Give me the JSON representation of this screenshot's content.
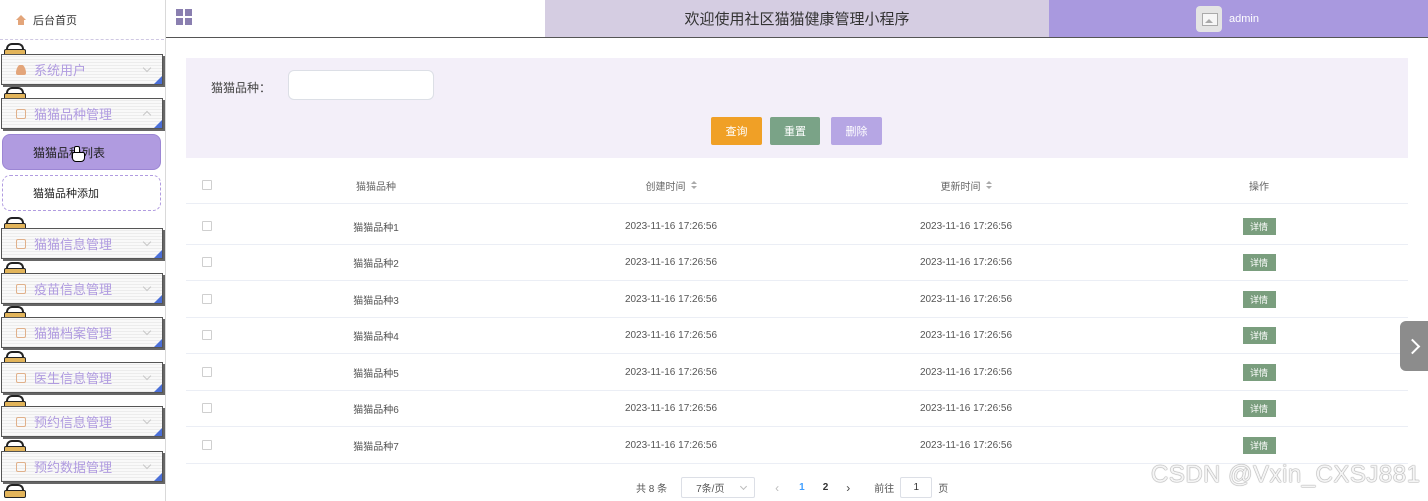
{
  "sidebar": {
    "home_label": "后台首页",
    "menus": [
      {
        "label": "系统用户",
        "icon": "user-icon"
      },
      {
        "label": "猫猫品种管理",
        "icon": "folder-icon"
      },
      {
        "label": "猫猫信息管理",
        "icon": "folder-icon"
      },
      {
        "label": "疫苗信息管理",
        "icon": "folder-icon"
      },
      {
        "label": "猫猫档案管理",
        "icon": "folder-icon"
      },
      {
        "label": "医生信息管理",
        "icon": "folder-icon"
      },
      {
        "label": "预约信息管理",
        "icon": "folder-icon"
      },
      {
        "label": "预约数据管理",
        "icon": "folder-icon"
      }
    ],
    "submenu": [
      {
        "label": "猫猫品种列表",
        "active": true
      },
      {
        "label": "猫猫品种添加",
        "active": false
      }
    ]
  },
  "header": {
    "title": "欢迎使用社区猫猫健康管理小程序",
    "username": "admin",
    "title_bg": "#d5cde2",
    "user_bg": "#a999df"
  },
  "search": {
    "label": "猫猫品种：",
    "value": "",
    "placeholder": "",
    "buttons": {
      "query": "查询",
      "reset": "重置",
      "delete": "删除"
    }
  },
  "table": {
    "headers": {
      "name": "猫猫品种",
      "created": "创建时间",
      "updated": "更新时间",
      "ops": "操作"
    },
    "rows": [
      {
        "name": "猫猫品种1",
        "created": "2023-11-16 17:26:56",
        "updated": "2023-11-16 17:26:56",
        "action": "详情"
      },
      {
        "name": "猫猫品种2",
        "created": "2023-11-16 17:26:56",
        "updated": "2023-11-16 17:26:56",
        "action": "详情"
      },
      {
        "name": "猫猫品种3",
        "created": "2023-11-16 17:26:56",
        "updated": "2023-11-16 17:26:56",
        "action": "详情"
      },
      {
        "name": "猫猫品种4",
        "created": "2023-11-16 17:26:56",
        "updated": "2023-11-16 17:26:56",
        "action": "详情"
      },
      {
        "name": "猫猫品种5",
        "created": "2023-11-16 17:26:56",
        "updated": "2023-11-16 17:26:56",
        "action": "详情"
      },
      {
        "name": "猫猫品种6",
        "created": "2023-11-16 17:26:56",
        "updated": "2023-11-16 17:26:56",
        "action": "详情"
      },
      {
        "name": "猫猫品种7",
        "created": "2023-11-16 17:26:56",
        "updated": "2023-11-16 17:26:56",
        "action": "详情"
      }
    ]
  },
  "pagination": {
    "total": "共 8 条",
    "page_size": "7条/页",
    "pages": [
      "1",
      "2"
    ],
    "current_page": "1",
    "goto_label": "前往",
    "goto_value": "1",
    "page_suffix": "页"
  },
  "watermark": "CSDN @Vxin_CXSJ881"
}
